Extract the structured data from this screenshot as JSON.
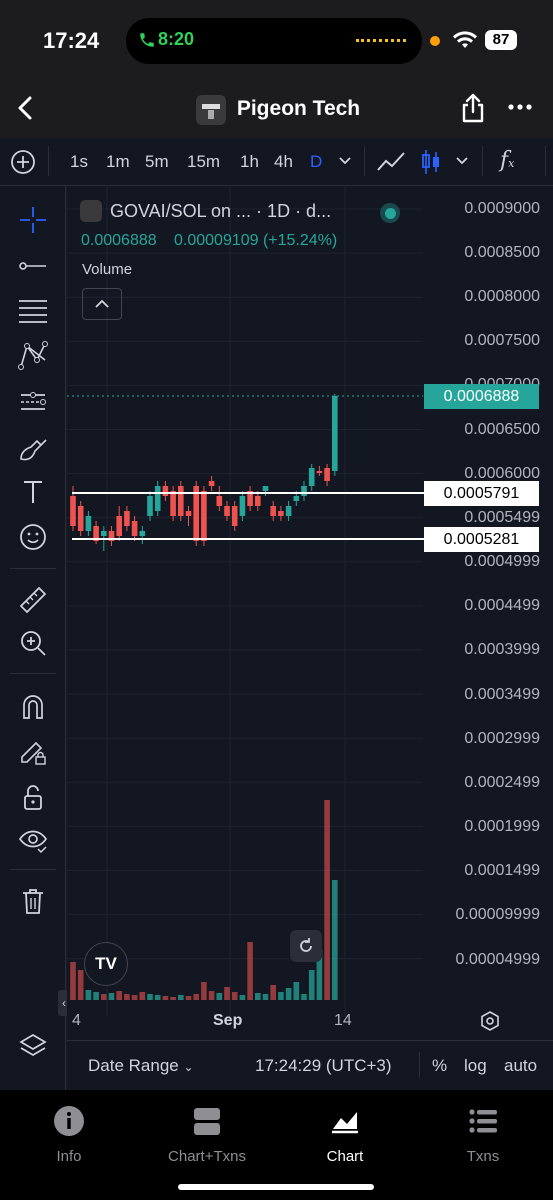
{
  "status_bar": {
    "time": "17:24",
    "call_time": "8:20",
    "battery": "87"
  },
  "nav": {
    "title": "Pigeon Tech"
  },
  "toolbar": {
    "intervals": [
      "1s",
      "1m",
      "5m",
      "15m",
      "1h",
      "4h",
      "D"
    ],
    "active_interval": "D"
  },
  "chart": {
    "symbol": "GOVAI/SOL on ... · 1D · d...",
    "last_price": "0.0006888",
    "change": "0.00009109 (+15.24%)",
    "volume_label": "Volume",
    "price_axis": [
      "0.0009000",
      "0.0008500",
      "0.0008000",
      "0.0007500",
      "0.0007000",
      "0.0006500",
      "0.0006000",
      "0.0005499",
      "0.0004999",
      "0.0004499",
      "0.0003999",
      "0.0003499",
      "0.0002999",
      "0.0002499",
      "0.0001999",
      "0.0001499",
      "0.00009999",
      "0.00004999"
    ],
    "current_price_tag": "0.0006888",
    "hline_upper": "0.0005791",
    "hline_lower": "0.0005281",
    "time_axis": [
      "4",
      "Sep",
      "14"
    ],
    "colors": {
      "up": "#26a69a",
      "down": "#ef5350",
      "accent": "#2962ff"
    }
  },
  "bottom_bar": {
    "date_range": "Date Range",
    "clock": "17:24:29 (UTC+3)",
    "percent": "%",
    "log": "log",
    "auto": "auto"
  },
  "tabs": [
    {
      "label": "Info",
      "icon": "info-icon"
    },
    {
      "label": "Chart+Txns",
      "icon": "split-view-icon"
    },
    {
      "label": "Chart",
      "icon": "chart-icon",
      "active": true
    },
    {
      "label": "Txns",
      "icon": "list-icon"
    }
  ]
}
